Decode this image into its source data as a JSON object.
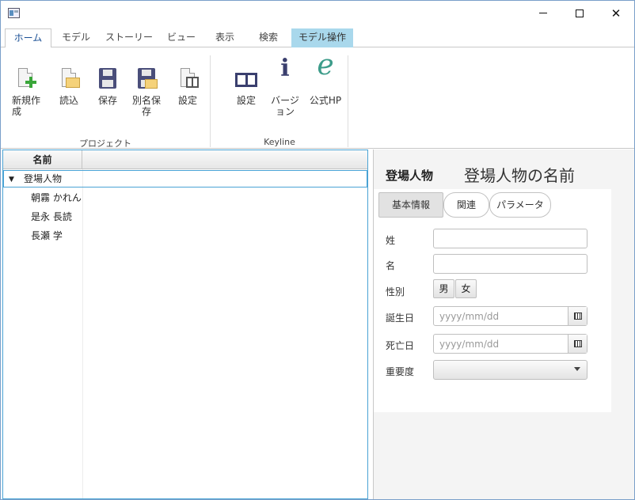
{
  "window": {
    "controls": {
      "minimize": "minimize",
      "maximize": "maximize",
      "close": "✕"
    }
  },
  "tabs": [
    {
      "label": "ホーム",
      "active": true
    },
    {
      "label": "モデル"
    },
    {
      "label": "ストーリー"
    },
    {
      "label": "ビュー"
    },
    {
      "label": "表示"
    },
    {
      "label": "検索"
    },
    {
      "label": "モデル操作",
      "contextual": true
    }
  ],
  "ribbon": {
    "project_group": {
      "label": "プロジェクト",
      "buttons": [
        {
          "label": "新規作成",
          "icon": "new-file-icon"
        },
        {
          "label": "読込",
          "icon": "open-folder-icon"
        },
        {
          "label": "保存",
          "icon": "save-icon"
        },
        {
          "label": "別名保存",
          "icon": "save-as-icon"
        },
        {
          "label": "設定",
          "icon": "project-settings-icon"
        }
      ]
    },
    "keyline_group": {
      "label": "Keyline",
      "buttons": [
        {
          "label": "設定",
          "icon": "panels-icon"
        },
        {
          "label": "バージョン",
          "icon": "info-icon"
        },
        {
          "label": "公式HP",
          "icon": "homepage-logo-icon"
        }
      ]
    }
  },
  "tree": {
    "column_header": "名前",
    "root": {
      "label": "登場人物",
      "expanded": true
    },
    "children": [
      "朝霧 かれん",
      "是永 長読",
      "長瀬 学"
    ]
  },
  "detail": {
    "title": "登場人物",
    "name_placeholder": "登場人物の名前",
    "tabs": [
      "基本情報",
      "関連",
      "パラメータ"
    ],
    "fields": {
      "last_name_label": "姓",
      "last_name_value": "",
      "first_name_label": "名",
      "first_name_value": "",
      "gender_label": "性別",
      "gender_options": [
        "男",
        "女"
      ],
      "birthday_label": "誕生日",
      "birthday_placeholder": "yyyy/mm/dd",
      "deathday_label": "死亡日",
      "deathday_placeholder": "yyyy/mm/dd",
      "importance_label": "重要度",
      "importance_value": ""
    }
  },
  "colors": {
    "accent": "#4aa3d5",
    "context_tab": "#a9d8ec",
    "active_tab_text": "#1a4f95"
  }
}
